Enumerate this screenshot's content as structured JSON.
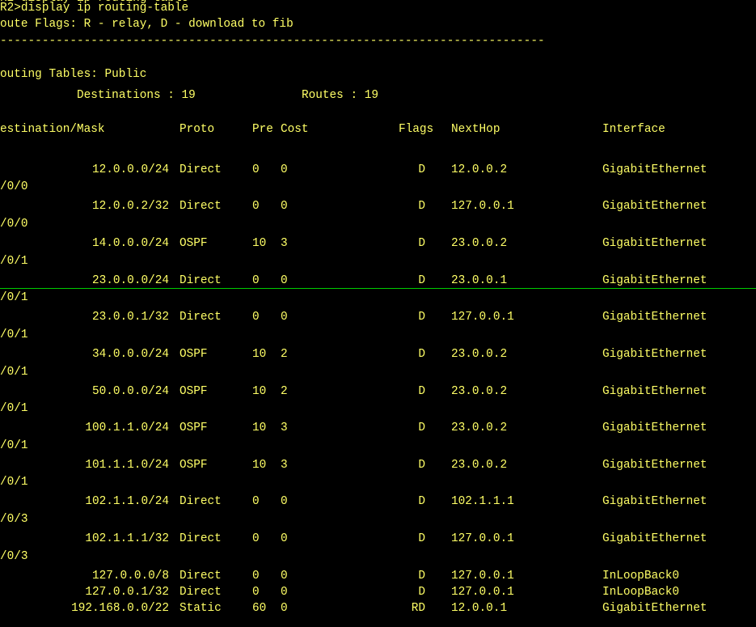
{
  "terminal": {
    "partial_top_line": "R2>display ip routing-table",
    "command_line": "R2>display ip routing-table",
    "flags_line": "oute Flags: R - relay, D - download to fib",
    "dashes_line": "------------------------------------------------------------------------------",
    "table_title": "outing Tables: Public",
    "destinations_label": "Destinations : 19",
    "routes_label": "Routes : 19",
    "headers": {
      "destination": "estination/Mask",
      "proto": "Proto",
      "pre": "Pre",
      "cost": "Cost",
      "flags": "Flags",
      "nexthop": "NextHop",
      "interface": "Interface"
    },
    "routes": [
      {
        "dest": "12.0.0.0/24",
        "proto": "Direct",
        "pre": "0",
        "cost": "0",
        "flags": "D",
        "nexthop": "12.0.0.2",
        "iface": "GigabitEthernet",
        "wrap": "/0/0"
      },
      {
        "dest": "12.0.0.2/32",
        "proto": "Direct",
        "pre": "0",
        "cost": "0",
        "flags": "D",
        "nexthop": "127.0.0.1",
        "iface": "GigabitEthernet",
        "wrap": "/0/0"
      },
      {
        "dest": "14.0.0.0/24",
        "proto": "OSPF",
        "pre": "10",
        "cost": "3",
        "flags": "D",
        "nexthop": "23.0.0.2",
        "iface": "GigabitEthernet",
        "wrap": "/0/1"
      },
      {
        "dest": "23.0.0.0/24",
        "proto": "Direct",
        "pre": "0",
        "cost": "0",
        "flags": "D",
        "nexthop": "23.0.0.1",
        "iface": "GigabitEthernet",
        "wrap": "/0/1"
      },
      {
        "dest": "23.0.0.1/32",
        "proto": "Direct",
        "pre": "0",
        "cost": "0",
        "flags": "D",
        "nexthop": "127.0.0.1",
        "iface": "GigabitEthernet",
        "wrap": "/0/1"
      },
      {
        "dest": "34.0.0.0/24",
        "proto": "OSPF",
        "pre": "10",
        "cost": "2",
        "flags": "D",
        "nexthop": "23.0.0.2",
        "iface": "GigabitEthernet",
        "wrap": "/0/1"
      },
      {
        "dest": "50.0.0.0/24",
        "proto": "OSPF",
        "pre": "10",
        "cost": "2",
        "flags": "D",
        "nexthop": "23.0.0.2",
        "iface": "GigabitEthernet",
        "wrap": "/0/1"
      },
      {
        "dest": "100.1.1.0/24",
        "proto": "OSPF",
        "pre": "10",
        "cost": "3",
        "flags": "D",
        "nexthop": "23.0.0.2",
        "iface": "GigabitEthernet",
        "wrap": "/0/1"
      },
      {
        "dest": "101.1.1.0/24",
        "proto": "OSPF",
        "pre": "10",
        "cost": "3",
        "flags": "D",
        "nexthop": "23.0.0.2",
        "iface": "GigabitEthernet",
        "wrap": "/0/1"
      },
      {
        "dest": "102.1.1.0/24",
        "proto": "Direct",
        "pre": "0",
        "cost": "0",
        "flags": "D",
        "nexthop": "102.1.1.1",
        "iface": "GigabitEthernet",
        "wrap": "/0/3"
      },
      {
        "dest": "102.1.1.1/32",
        "proto": "Direct",
        "pre": "0",
        "cost": "0",
        "flags": "D",
        "nexthop": "127.0.0.1",
        "iface": "GigabitEthernet",
        "wrap": "/0/3"
      },
      {
        "dest": "127.0.0.0/8",
        "proto": "Direct",
        "pre": "0",
        "cost": "0",
        "flags": "D",
        "nexthop": "127.0.0.1",
        "iface": "InLoopBack0",
        "wrap": ""
      },
      {
        "dest": "127.0.0.1/32",
        "proto": "Direct",
        "pre": "0",
        "cost": "0",
        "flags": "D",
        "nexthop": "127.0.0.1",
        "iface": "InLoopBack0",
        "wrap": ""
      },
      {
        "dest": "192.168.0.0/22",
        "proto": "Static",
        "pre": "60",
        "cost": "0",
        "flags": "RD",
        "nexthop": "12.0.0.1",
        "iface": "GigabitEthernet",
        "wrap": ""
      }
    ]
  },
  "colors": {
    "background": "#000000",
    "text": "#ffff66",
    "rule": "#00cc00"
  }
}
